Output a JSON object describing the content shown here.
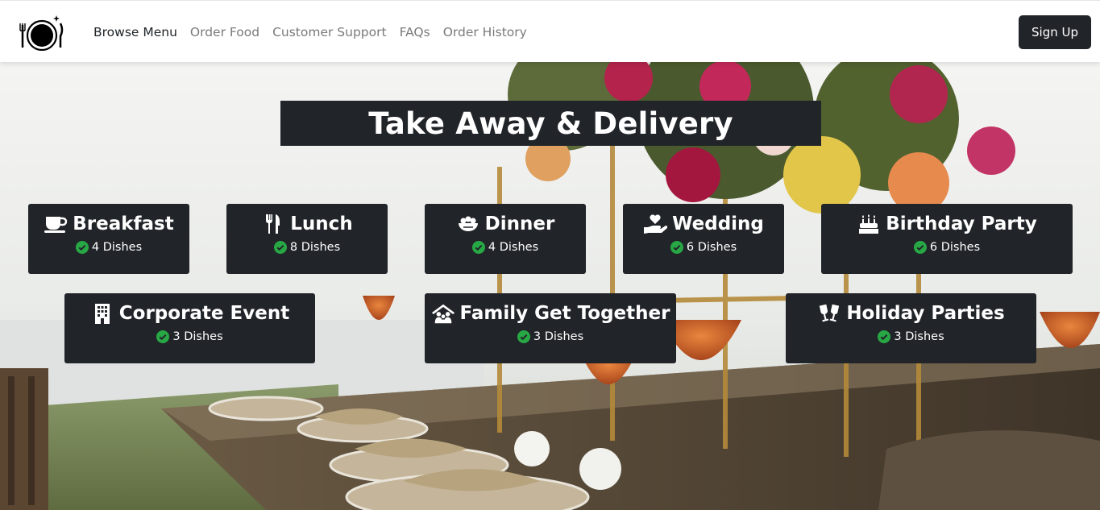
{
  "nav": {
    "links": [
      {
        "label": "Browse Menu"
      },
      {
        "label": "Order Food"
      },
      {
        "label": "Customer Support"
      },
      {
        "label": "FAQs"
      },
      {
        "label": "Order History"
      }
    ],
    "signup_label": "Sign Up"
  },
  "hero": {
    "title": "Take Away & Delivery"
  },
  "categories": [
    {
      "name": "Breakfast",
      "dishes": "4 Dishes",
      "icon": "coffee-cup-icon"
    },
    {
      "name": "Lunch",
      "dishes": "8 Dishes",
      "icon": "utensils-icon"
    },
    {
      "name": "Dinner",
      "dishes": "4 Dishes",
      "icon": "bowl-food-icon"
    },
    {
      "name": "Wedding",
      "dishes": "6 Dishes",
      "icon": "hand-holding-heart-icon"
    },
    {
      "name": "Birthday Party",
      "dishes": "6 Dishes",
      "icon": "birthday-cake-icon"
    },
    {
      "name": "Corporate Event",
      "dishes": "3 Dishes",
      "icon": "building-icon"
    },
    {
      "name": "Family Get Together",
      "dishes": "3 Dishes",
      "icon": "family-house-icon"
    },
    {
      "name": "Holiday Parties",
      "dishes": "3 Dishes",
      "icon": "glasses-cheers-icon"
    }
  ],
  "colors": {
    "dark": "#212529",
    "check": "#28a745",
    "accent_link": "#212529"
  }
}
